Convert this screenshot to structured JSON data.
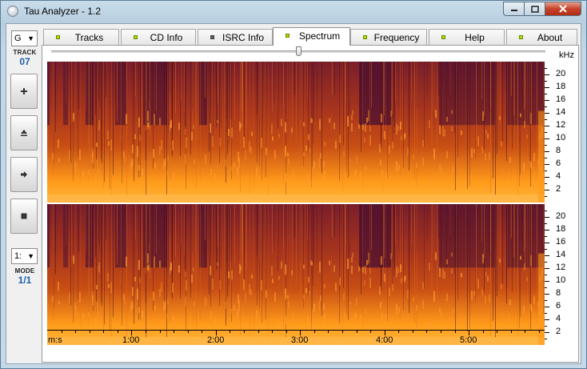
{
  "window": {
    "title": "Tau Analyzer - 1.2"
  },
  "left_panel": {
    "combo_top": "G",
    "track_label": "TRACK",
    "track_number": "07",
    "combo_mode": "1:",
    "mode_label": "MODE",
    "mode_value": "1/1"
  },
  "tabs": [
    {
      "label": "Tracks",
      "led": "on"
    },
    {
      "label": "CD Info",
      "led": "on"
    },
    {
      "label": "ISRC Info",
      "led": "off"
    },
    {
      "label": "Spectrum",
      "led": "on",
      "active": true
    },
    {
      "label": "Frequency",
      "led": "on"
    },
    {
      "label": "Help",
      "led": "on"
    },
    {
      "label": "About",
      "led": "on"
    }
  ],
  "spectrum": {
    "unit_label": "kHz",
    "freq_ticks": [
      "20",
      "18",
      "16",
      "14",
      "12",
      "10",
      "8",
      "6",
      "4",
      "2"
    ],
    "time_axis_label": "m:s",
    "time_ticks": [
      "1:00",
      "2:00",
      "3:00",
      "4:00",
      "5:00"
    ],
    "colors": {
      "hot": "#ff9a1a",
      "mid": "#d25a10",
      "cold": "#4a1030"
    }
  }
}
